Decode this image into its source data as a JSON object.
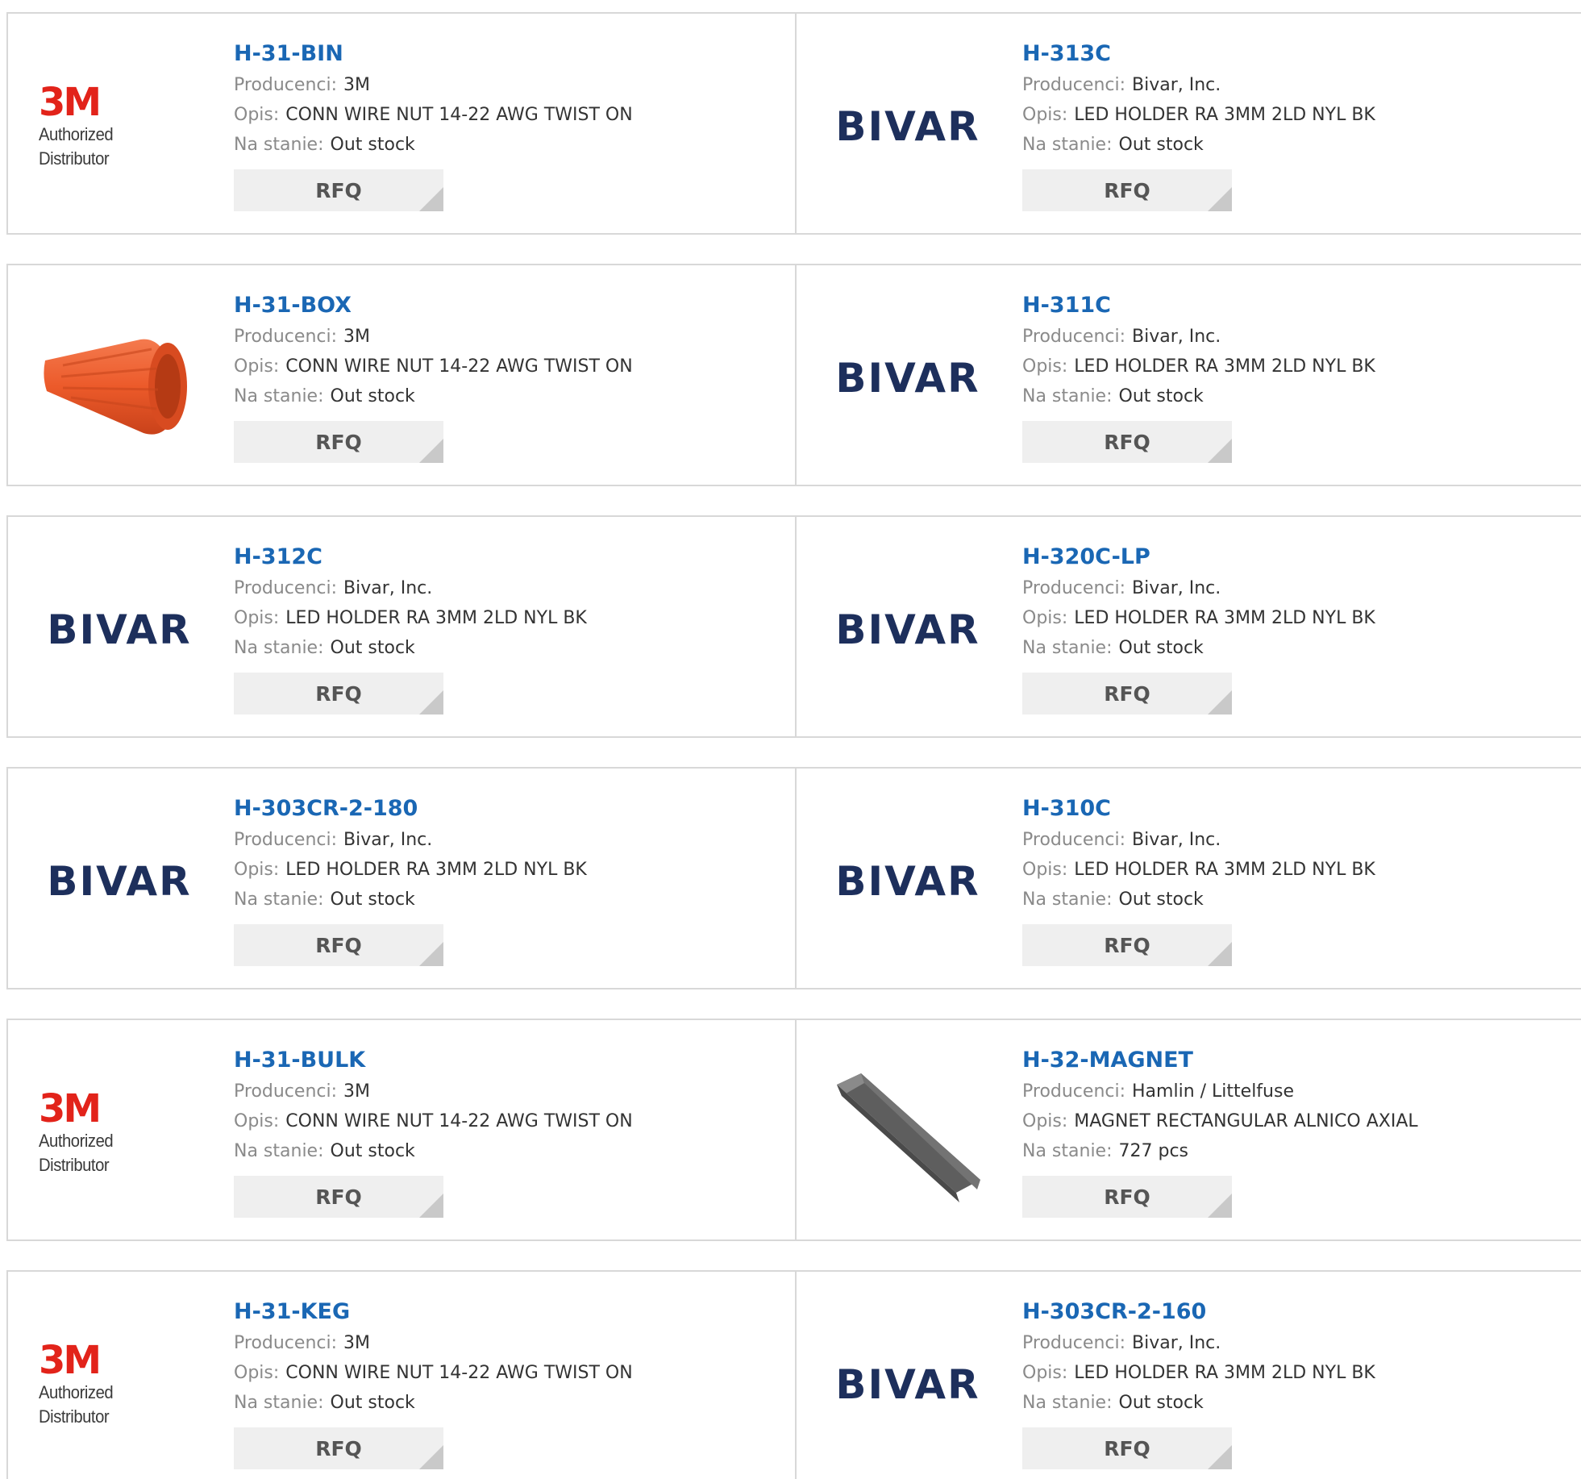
{
  "labels": {
    "manufacturer": "Producenci:",
    "description": "Opis:",
    "stock": "Na stanie:",
    "rfq": "RFQ"
  },
  "logos": {
    "3m_mark": "3M",
    "3m_sub": "Authorized Distributor",
    "bivar": "BIVAR"
  },
  "colors": {
    "part_link": "#1a67b4",
    "brand_3m": "#e2231a",
    "brand_bivar": "#1d2f5c",
    "wire_nut": "#ef5a2c"
  },
  "products": [
    {
      "part": "H-31-BIN",
      "manufacturer": "3M",
      "description": "CONN WIRE NUT 14-22 AWG TWIST ON",
      "stock": "Out stock",
      "image": "3m-logo"
    },
    {
      "part": "H-313C",
      "manufacturer": "Bivar, Inc.",
      "description": "LED HOLDER RA 3MM 2LD NYL BK",
      "stock": "Out stock",
      "image": "bivar-logo"
    },
    {
      "part": "H-31-BOX",
      "manufacturer": "3M",
      "description": "CONN WIRE NUT 14-22 AWG TWIST ON",
      "stock": "Out stock",
      "image": "wire-nut-photo"
    },
    {
      "part": "H-311C",
      "manufacturer": "Bivar, Inc.",
      "description": "LED HOLDER RA 3MM 2LD NYL BK",
      "stock": "Out stock",
      "image": "bivar-logo"
    },
    {
      "part": "H-312C",
      "manufacturer": "Bivar, Inc.",
      "description": "LED HOLDER RA 3MM 2LD NYL BK",
      "stock": "Out stock",
      "image": "bivar-logo"
    },
    {
      "part": "H-320C-LP",
      "manufacturer": "Bivar, Inc.",
      "description": "LED HOLDER RA 3MM 2LD NYL BK",
      "stock": "Out stock",
      "image": "bivar-logo"
    },
    {
      "part": "H-303CR-2-180",
      "manufacturer": "Bivar, Inc.",
      "description": "LED HOLDER RA 3MM 2LD NYL BK",
      "stock": "Out stock",
      "image": "bivar-logo"
    },
    {
      "part": "H-310C",
      "manufacturer": "Bivar, Inc.",
      "description": "LED HOLDER RA 3MM 2LD NYL BK",
      "stock": "Out stock",
      "image": "bivar-logo"
    },
    {
      "part": "H-31-BULK",
      "manufacturer": "3M",
      "description": "CONN WIRE NUT 14-22 AWG TWIST ON",
      "stock": "Out stock",
      "image": "3m-logo"
    },
    {
      "part": "H-32-MAGNET",
      "manufacturer": "Hamlin / Littelfuse",
      "description": "MAGNET RECTANGULAR ALNICO AXIAL",
      "stock": "727 pcs",
      "image": "magnet-photo"
    },
    {
      "part": "H-31-KEG",
      "manufacturer": "3M",
      "description": "CONN WIRE NUT 14-22 AWG TWIST ON",
      "stock": "Out stock",
      "image": "3m-logo"
    },
    {
      "part": "H-303CR-2-160",
      "manufacturer": "Bivar, Inc.",
      "description": "LED HOLDER RA 3MM 2LD NYL BK",
      "stock": "Out stock",
      "image": "bivar-logo"
    }
  ]
}
